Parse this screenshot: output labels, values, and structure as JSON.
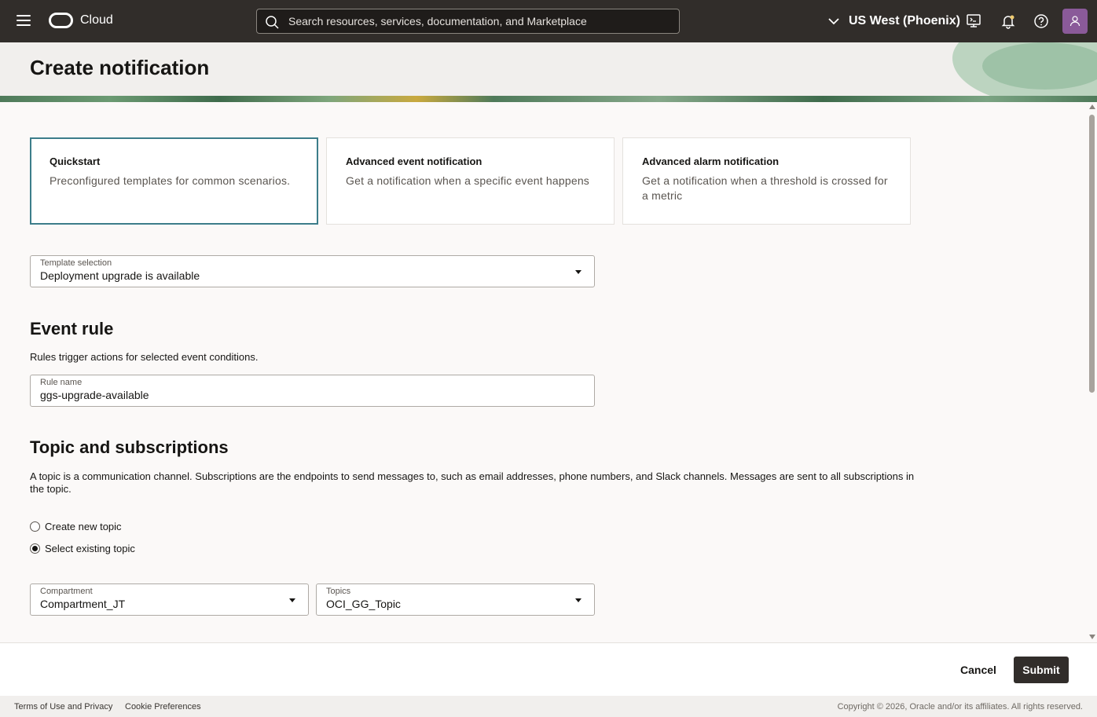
{
  "topbar": {
    "brand": "Cloud",
    "search_placeholder": "Search resources, services, documentation, and Marketplace",
    "region": "US West (Phoenix)",
    "icons": [
      "menu-icon",
      "oracle-logo-icon",
      "search-icon",
      "chevron-down-icon",
      "cloud-shell-icon",
      "bell-icon",
      "help-icon",
      "user-icon"
    ]
  },
  "page": {
    "title": "Create notification"
  },
  "cards": [
    {
      "title": "Quickstart",
      "desc": "Preconfigured templates for common scenarios."
    },
    {
      "title": "Advanced event notification",
      "desc": "Get a notification when a specific event happens"
    },
    {
      "title": "Advanced alarm notification",
      "desc": "Get a notification when a threshold is crossed for a metric"
    }
  ],
  "template": {
    "label": "Template selection",
    "value": "Deployment upgrade is available"
  },
  "event_rule": {
    "heading": "Event rule",
    "desc": "Rules trigger actions for selected event conditions.",
    "rule_name_label": "Rule name",
    "rule_name_value": "ggs-upgrade-available"
  },
  "topics": {
    "heading": "Topic and subscriptions",
    "desc": "A topic is a communication channel. Subscriptions are the endpoints to send messages to, such as email addresses, phone numbers, and Slack channels. Messages are sent to all subscriptions in the topic.",
    "radio_new": "Create new topic",
    "radio_existing": "Select existing topic",
    "selected_option": "existing",
    "compartment_label": "Compartment",
    "compartment_value": "Compartment_JT",
    "topics_label": "Topics",
    "topics_value": "OCI_GG_Topic"
  },
  "actions": {
    "cancel": "Cancel",
    "submit": "Submit"
  },
  "footer": {
    "terms": "Terms of Use and Privacy",
    "cookies": "Cookie Preferences",
    "copyright": "Copyright © 2026, Oracle and/or its affiliates. All rights reserved."
  },
  "colors": {
    "topbar": "#312d2a",
    "selected_card_border": "#3c7d8a",
    "avatar": "#8a5a99",
    "submit_button": "#312d2a"
  }
}
